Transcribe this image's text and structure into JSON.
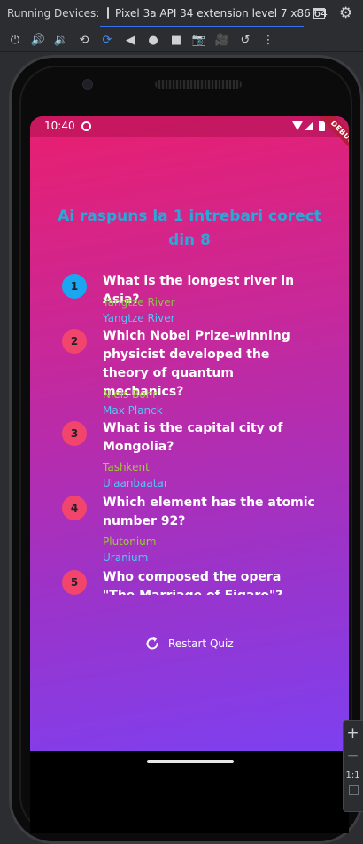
{
  "ide": {
    "running_devices_label": "Running Devices:",
    "device_tab_label": "Pixel 3a API 34 extension level 7 x86 64",
    "toolbar_icons": [
      "power-icon",
      "volume-up-icon",
      "volume-down-icon",
      "rotate-left-icon",
      "rotate-right-icon",
      "back-icon",
      "home-icon",
      "overview-icon",
      "camera-icon",
      "record-icon",
      "restore-icon",
      "more-icon"
    ],
    "zoom_in": "+",
    "zoom_out": "−",
    "zoom_actual": "1:1"
  },
  "phone": {
    "status_time": "10:40",
    "debug_banner": "DEBUG"
  },
  "quiz": {
    "result_title": "Ai raspuns la 1 intrebari corect din 8",
    "restart_label": "Restart Quiz",
    "colors": {
      "correct_badge": "#1aa6f0",
      "wrong_badge": "#f2456d",
      "user_answer_correct": "#8bc34a",
      "user_answer_wrong": "#9acd32",
      "correct_answer": "#4fc8f7",
      "title": "#27a9d9"
    },
    "summary": [
      {
        "number": "1",
        "question": "What is the longest river in Asia?",
        "user_answer": "Yangtze River",
        "correct_answer": "Yangtze River",
        "is_correct": true
      },
      {
        "number": "2",
        "question": "Which Nobel Prize-winning physicist developed the theory of quantum mechanics?",
        "user_answer": "Niels Bohr",
        "correct_answer": "Max Planck",
        "is_correct": false
      },
      {
        "number": "3",
        "question": "What is the capital city of Mongolia?",
        "user_answer": "Tashkent",
        "correct_answer": "Ulaanbaatar",
        "is_correct": false
      },
      {
        "number": "4",
        "question": "Which element has the atomic number 92?",
        "user_answer": "Plutonium",
        "correct_answer": "Uranium",
        "is_correct": false
      },
      {
        "number": "5",
        "question": "Who composed the opera \"The Marriage of Figaro\"?",
        "user_answer": "",
        "correct_answer": "",
        "is_correct": false
      }
    ]
  }
}
